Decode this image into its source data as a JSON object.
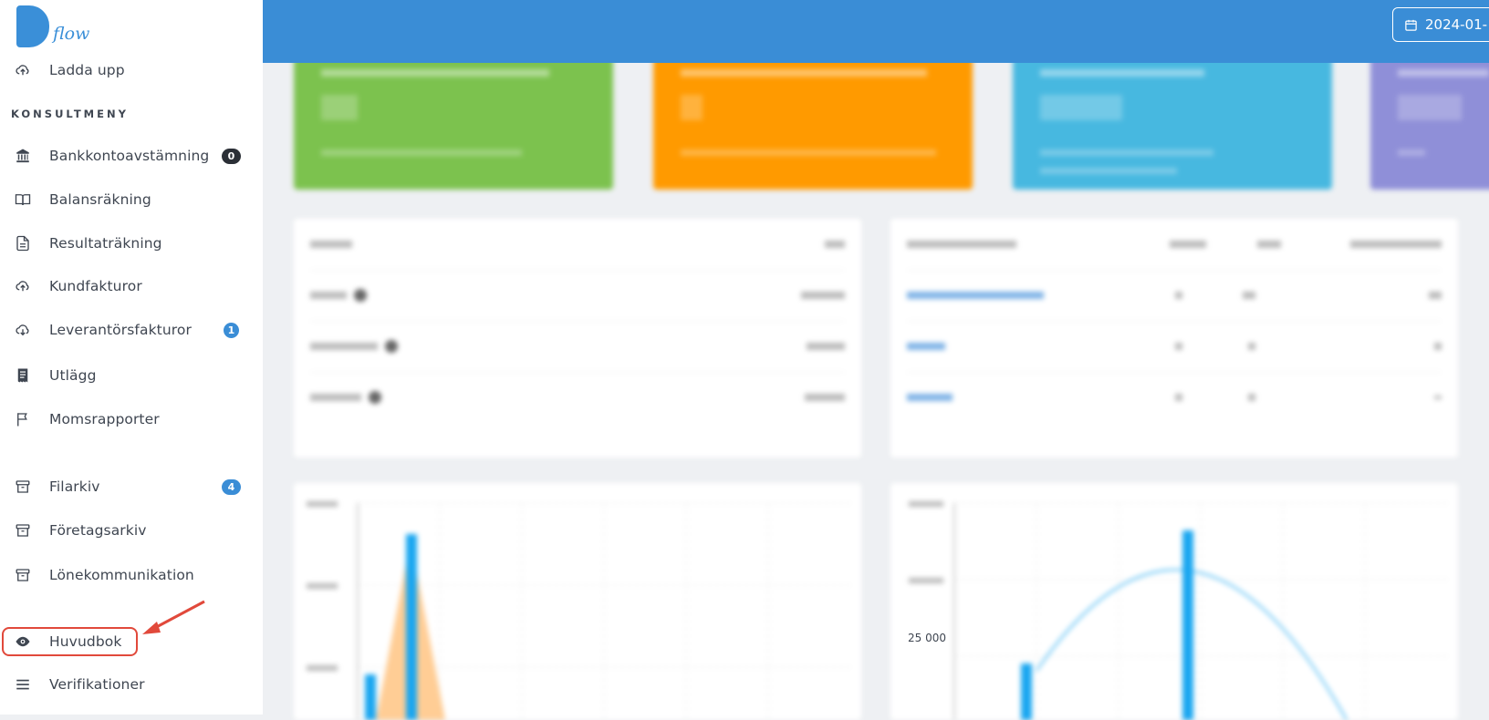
{
  "brand": {
    "logo_text": "flow"
  },
  "sidebar": {
    "upload_label": "Ladda upp",
    "section_title": "KONSULTMENY",
    "items": [
      {
        "label": "Bankkontoavstämning",
        "icon": "bank-icon",
        "badge": "0"
      },
      {
        "label": "Balansräkning",
        "icon": "book-icon"
      },
      {
        "label": "Resultaträkning",
        "icon": "document-icon"
      },
      {
        "label": "Kundfakturor",
        "icon": "cloud-upload-icon"
      },
      {
        "label": "Leverantörsfakturor",
        "icon": "cloud-download-icon",
        "badge": "1"
      },
      {
        "label": "Utlägg",
        "icon": "receipt-icon"
      },
      {
        "label": "Momsrapporter",
        "icon": "flag-icon"
      },
      {
        "label": "Filarkiv",
        "icon": "archive-icon",
        "badge": "4"
      },
      {
        "label": "Företagsarkiv",
        "icon": "archive-icon"
      },
      {
        "label": "Lönekommunikation",
        "icon": "archive-icon"
      },
      {
        "label": "Huvudbok",
        "icon": "eye-icon",
        "highlighted": true
      },
      {
        "label": "Verifikationer",
        "icon": "menu-icon"
      }
    ]
  },
  "topbar": {
    "date_label": "2024-01-"
  },
  "chart": {
    "visible_y_tick": "25 000"
  },
  "colors": {
    "accent": "#3a8dd6",
    "badge_dark": "#2b2f36",
    "highlight": "#e1493b",
    "kpi_green": "#7cc24e",
    "kpi_orange": "#ff9a00",
    "kpi_cyan": "#47b8e0",
    "kpi_purple": "#8f8fd8"
  }
}
